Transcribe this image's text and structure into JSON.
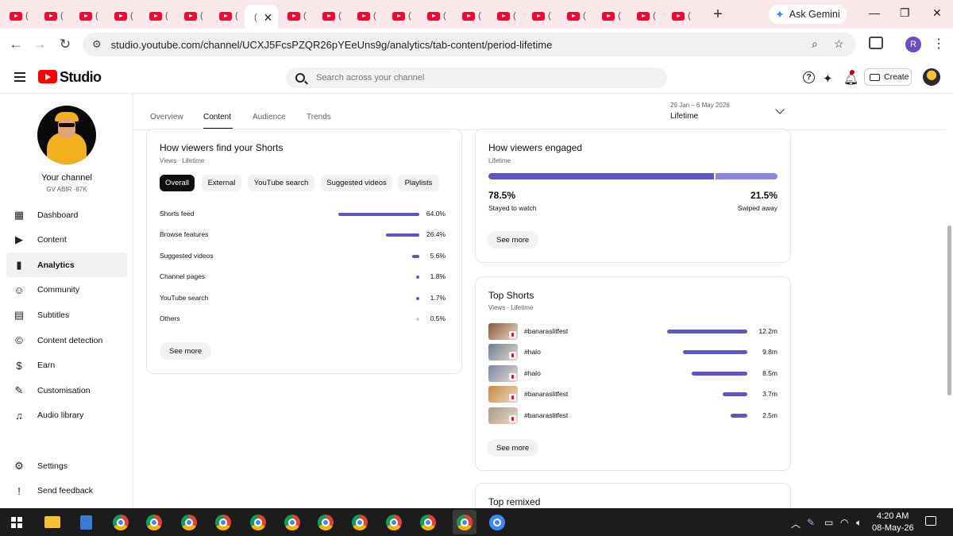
{
  "browser": {
    "tab_count": 20,
    "ask_gemini_label": "Ask Gemini",
    "url": "studio.youtube.com/channel/UCXJ5FcsPZQR26pYEeUns9g/analytics/tab-content/period-lifetime",
    "profile_initial": "R"
  },
  "header": {
    "app_name": "Studio",
    "search_placeholder": "Search across your channel",
    "create_label": "Create"
  },
  "sidebar": {
    "your_channel_label": "Your channel",
    "channel_handle": "GV ABIR -87K",
    "items": [
      {
        "label": "Dashboard",
        "icon": "dashboard-icon"
      },
      {
        "label": "Content",
        "icon": "content-icon"
      },
      {
        "label": "Analytics",
        "icon": "analytics-icon",
        "active": true
      },
      {
        "label": "Community",
        "icon": "community-icon"
      },
      {
        "label": "Subtitles",
        "icon": "subtitles-icon"
      },
      {
        "label": "Content detection",
        "icon": "copyright-icon"
      },
      {
        "label": "Earn",
        "icon": "earn-icon"
      },
      {
        "label": "Customisation",
        "icon": "customisation-icon"
      },
      {
        "label": "Audio library",
        "icon": "audio-library-icon"
      }
    ],
    "bottom_items": [
      {
        "label": "Settings",
        "icon": "settings-icon"
      },
      {
        "label": "Send feedback",
        "icon": "feedback-icon"
      }
    ]
  },
  "analytics": {
    "tabs": [
      "Overview",
      "Content",
      "Audience",
      "Trends"
    ],
    "active_tab": "Content",
    "period_range": "29 Jan – 6 May 2026",
    "period_name": "Lifetime"
  },
  "find_card": {
    "title": "How viewers find your Shorts",
    "subtitle": "Views · Lifetime",
    "chips": [
      "Overall",
      "External",
      "YouTube search",
      "Suggested videos",
      "Playlists"
    ],
    "selected_chip": "Overall",
    "rows": [
      {
        "label": "Shorts feed",
        "value": "64.0%",
        "pct": 64.0
      },
      {
        "label": "Browse features",
        "value": "26.4%",
        "pct": 26.4
      },
      {
        "label": "Suggested videos",
        "value": "5.6%",
        "pct": 5.6
      },
      {
        "label": "Channel pages",
        "value": "1.8%",
        "pct": 1.8
      },
      {
        "label": "YouTube search",
        "value": "1.7%",
        "pct": 1.7
      },
      {
        "label": "Others",
        "value": "0.5%",
        "pct": 0.5
      }
    ],
    "see_more": "See more"
  },
  "engaged_card": {
    "title": "How viewers engaged",
    "subtitle": "Lifetime",
    "stayed_pct": "78.5%",
    "stayed_label": "Stayed to watch",
    "swiped_pct": "21.5%",
    "swiped_label": "Swiped away",
    "stayed_fraction": 0.785,
    "see_more": "See more"
  },
  "top_shorts_card": {
    "title": "Top Shorts",
    "subtitle": "Views · Lifetime",
    "items": [
      {
        "title": "#banaraslitfest",
        "views": "12.2m",
        "value": 12.2
      },
      {
        "title": "#halo",
        "views": "9.8m",
        "value": 9.8
      },
      {
        "title": "#halo",
        "views": "8.5m",
        "value": 8.5
      },
      {
        "title": "#banaraslitfest",
        "views": "3.7m",
        "value": 3.7
      },
      {
        "title": "#banaraslitfest",
        "views": "2.5m",
        "value": 2.5
      }
    ],
    "see_more": "See more"
  },
  "top_remixed_card": {
    "title": "Top remixed"
  },
  "taskbar": {
    "time": "4:20 AM",
    "date": "08-May-26"
  }
}
